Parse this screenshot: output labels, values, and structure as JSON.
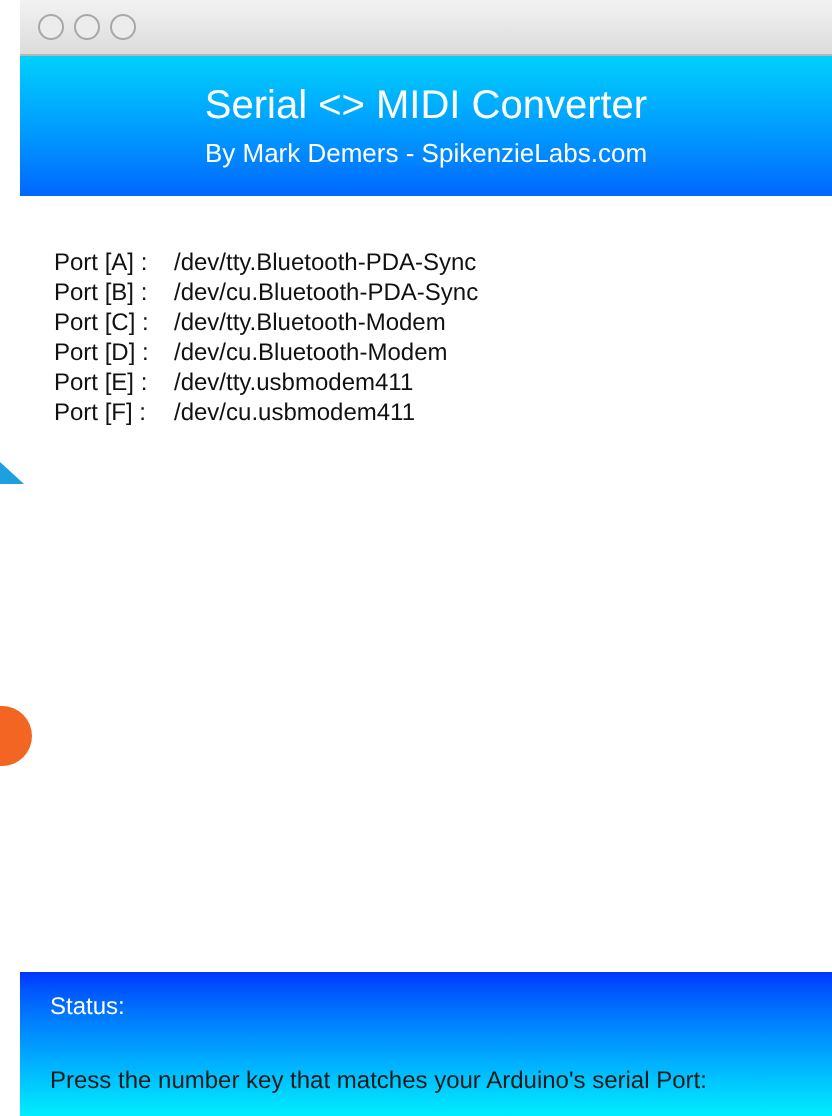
{
  "window": {
    "title": "Serial <> MIDI Converter",
    "subtitle": "By Mark Demers - SpikenzieLabs.com"
  },
  "ports": [
    {
      "label": "Port [A] :",
      "path": "/dev/tty.Bluetooth-PDA-Sync"
    },
    {
      "label": "Port [B] :",
      "path": "/dev/cu.Bluetooth-PDA-Sync"
    },
    {
      "label": "Port [C] :",
      "path": "/dev/tty.Bluetooth-Modem"
    },
    {
      "label": "Port [D] :",
      "path": "/dev/cu.Bluetooth-Modem"
    },
    {
      "label": "Port [E] :",
      "path": "/dev/tty.usbmodem411"
    },
    {
      "label": "Port [F] :",
      "path": "/dev/cu.usbmodem411"
    }
  ],
  "status_bar": {
    "label": "Status:",
    "message": "Press the number key that matches your Arduino's serial Port:"
  }
}
